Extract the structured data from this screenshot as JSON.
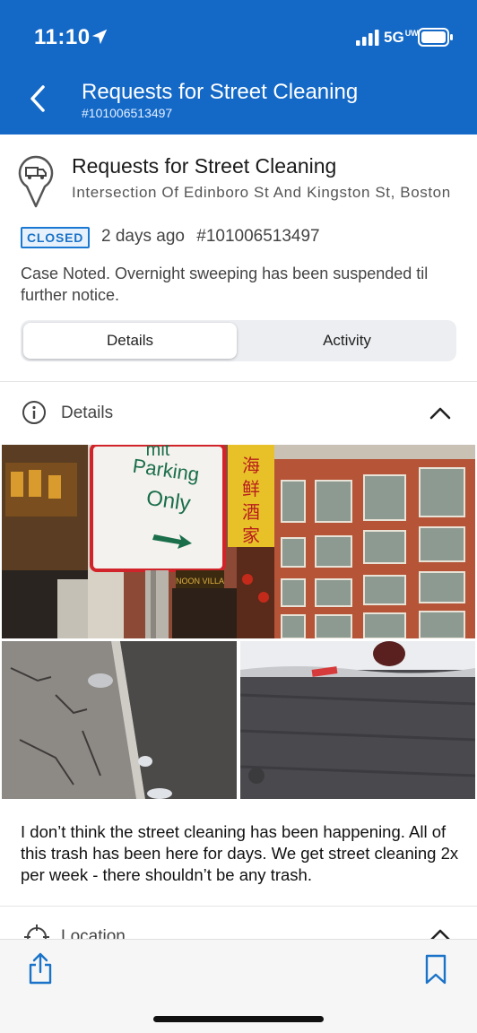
{
  "status_bar": {
    "time": "11:10",
    "network": "5G",
    "network_superscript": "UW"
  },
  "header": {
    "title": "Requests for Street Cleaning",
    "subtitle": "#101006513497",
    "back_icon": "chevron-left-icon"
  },
  "request": {
    "title": "Requests for Street Cleaning",
    "address": "Intersection Of Edinboro St And Kingston St, Boston",
    "status": "CLOSED",
    "age": "2 days ago",
    "case_number": "#101006513497",
    "note": "Case Noted. Overnight sweeping has been suspended til further notice."
  },
  "tabs": [
    {
      "label": "Details",
      "active": true
    },
    {
      "label": "Activity",
      "active": false
    }
  ],
  "details_section": {
    "label": "Details",
    "expanded": true
  },
  "photos": {
    "sign_text": "Parking Only",
    "sign_top_text": "mit",
    "chinese_sign": "海鲜酒家",
    "shop_sign": "NOON VILLA"
  },
  "description": "I don’t think the street cleaning has been happening. All of this trash has been here for days. We get street cleaning 2x per week - there shouldn’t be any trash.",
  "location_section": {
    "label": "Location",
    "expanded": true
  },
  "toolbar": {
    "share_icon": "share-icon",
    "bookmark_icon": "bookmark-icon"
  },
  "colors": {
    "brand": "#1469c7",
    "badge": "#1a78d2"
  }
}
